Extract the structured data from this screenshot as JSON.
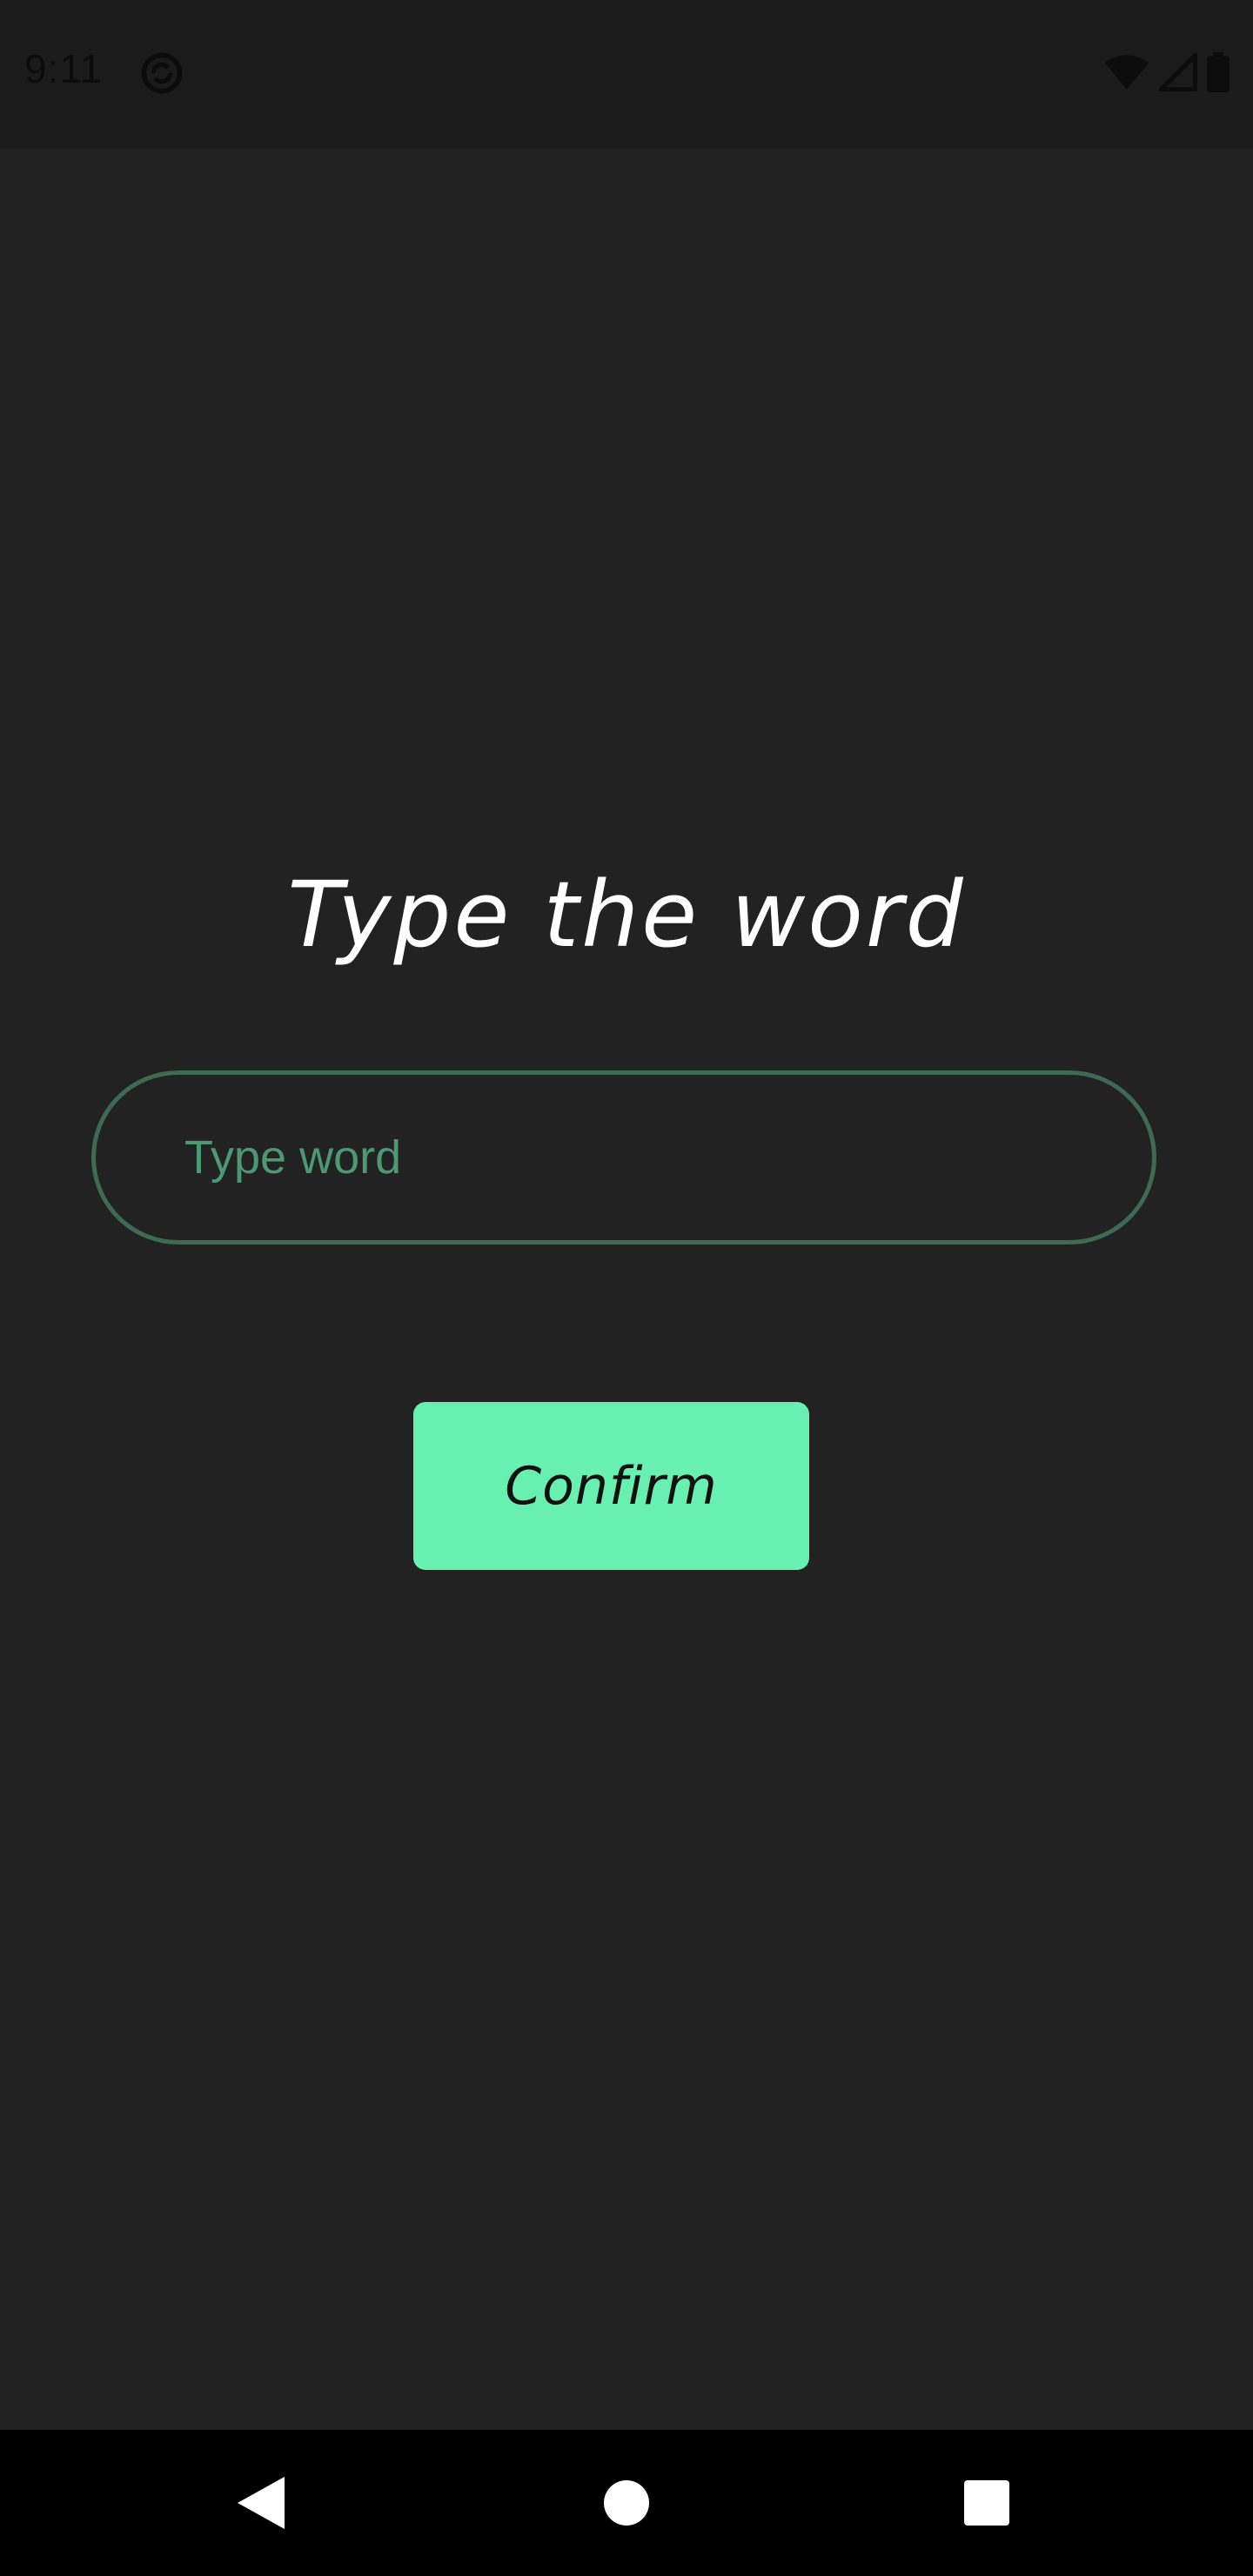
{
  "status_bar": {
    "time": "9:11",
    "icons": [
      "sync-icon",
      "wifi-icon",
      "signal-icon",
      "battery-icon"
    ]
  },
  "main": {
    "title": "Type the word",
    "word_input": {
      "placeholder": "Type word",
      "value": ""
    },
    "confirm_label": "Confirm"
  },
  "nav_bar": {
    "buttons": [
      "back-icon",
      "home-icon",
      "recents-icon"
    ]
  },
  "colors": {
    "background": "#222222",
    "status_bar": "#1b1b1b",
    "accent": "#68f0b1",
    "input_border": "#3c6a52",
    "placeholder": "#4b9873",
    "title_text": "#ffffff",
    "nav_bar": "#000000"
  }
}
